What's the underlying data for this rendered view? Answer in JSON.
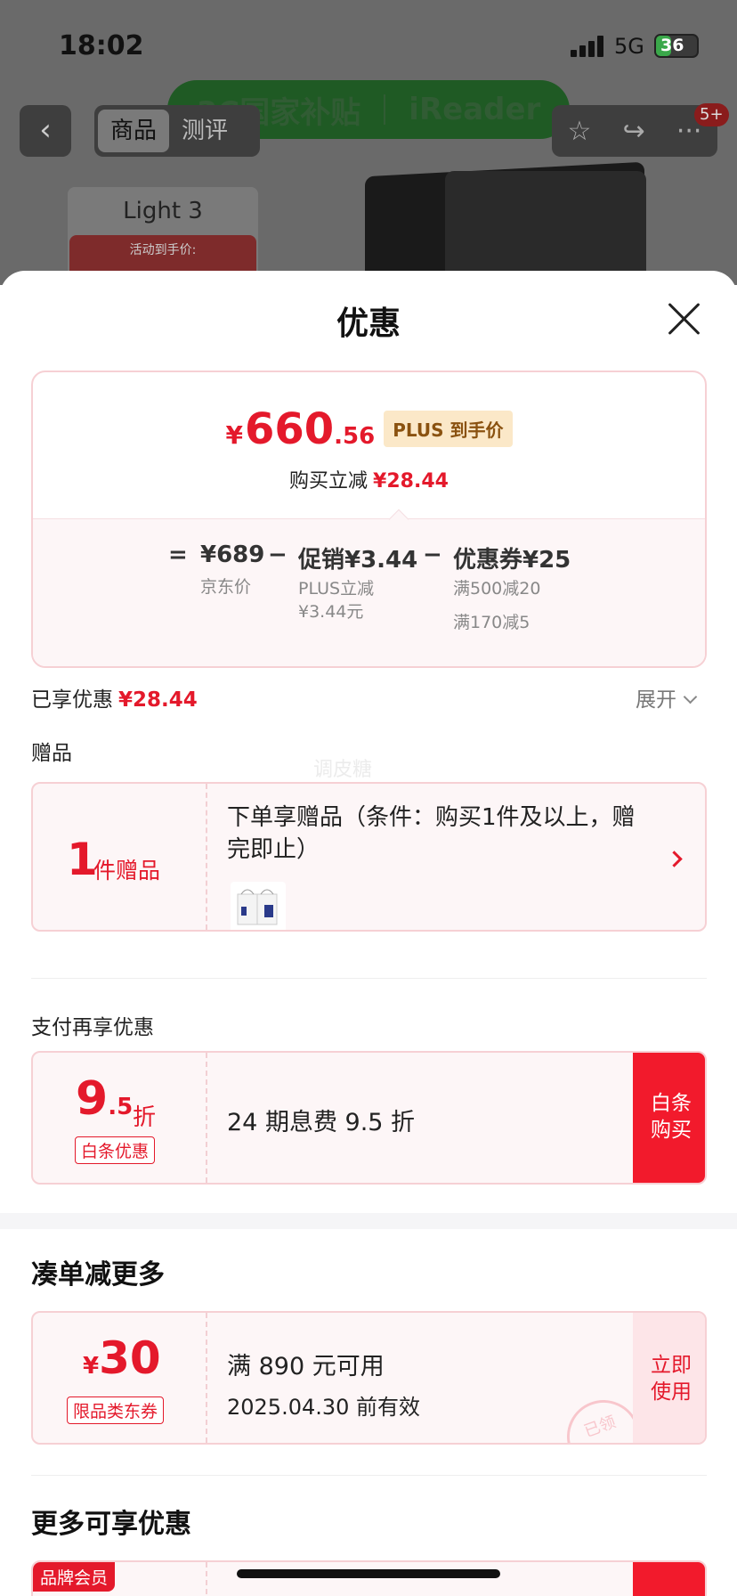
{
  "status": {
    "time": "18:02",
    "network": "5G",
    "battery": "36"
  },
  "background": {
    "banner_left": "3C国家补贴",
    "banner_right": "iReader",
    "tabs": [
      "商品",
      "测评"
    ],
    "badge": "5+",
    "product_title": "Light 3",
    "product_caption": "活动到手价:"
  },
  "sheet": {
    "title": "优惠",
    "price": {
      "yen": "¥",
      "integer": "660",
      "decimal": ".56",
      "plus_tag": "PLUS 到手价",
      "reduce_label": "购买立减",
      "reduce_value": "¥28.44"
    },
    "formula": {
      "equals": "=",
      "jd_price": "¥689",
      "jd_label": "京东价",
      "minus1": "−",
      "promo": "促销¥3.44",
      "promo_sub1": "PLUS立减",
      "promo_sub2": "¥3.44元",
      "minus2": "−",
      "coupon": "优惠券¥25",
      "coupon_sub1": "满500减20",
      "coupon_sub2": "满170减5"
    },
    "saved_label": "已享优惠",
    "saved_value": "¥28.44",
    "expand_label": "展开",
    "gift_section": "赠品",
    "watermark": "调皮糖",
    "gift": {
      "count": "1",
      "unit": "件赠品",
      "text": "下单享赠品（条件：购买1件及以上，赠完即止）"
    },
    "pay_section": "支付再享优惠",
    "pay": {
      "big": "9",
      "small": ".5",
      "zhe": "折",
      "tag": "白条优惠",
      "text": "24 期息费 9.5 折",
      "btn_line1": "白条",
      "btn_line2": "购买"
    },
    "more_heading": "凑单减更多",
    "coupon": {
      "yen": "¥",
      "amount": "30",
      "tag": "限品类东券",
      "line1": "满 890 元可用",
      "line2": "2025.04.30 前有效",
      "btn_line1": "立即",
      "btn_line2": "使用",
      "stamp": "已领"
    },
    "extra_heading": "更多可享优惠",
    "extra_tag": "品牌会员"
  }
}
